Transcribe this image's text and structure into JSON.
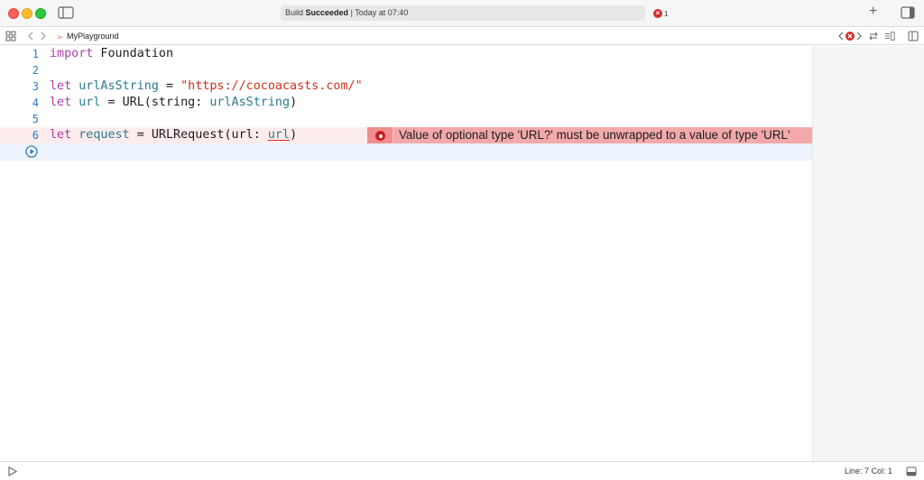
{
  "window": {
    "activity": {
      "prefix": "Build",
      "status": "Succeeded",
      "separator": "|",
      "time": "Today at 07:40"
    },
    "error_count": "1",
    "add_label": "+"
  },
  "jumpbar": {
    "file": "MyPlayground"
  },
  "editor": {
    "lines": [
      {
        "number": "1",
        "tokens": [
          {
            "t": "import",
            "k": "kw"
          },
          {
            "t": " Foundation"
          }
        ]
      },
      {
        "number": "2",
        "tokens": []
      },
      {
        "number": "3",
        "tokens": [
          {
            "t": "let",
            "k": "kw"
          },
          {
            "t": " "
          },
          {
            "t": "urlAsString",
            "k": "var"
          },
          {
            "t": " = "
          },
          {
            "t": "\"https://cocoacasts.com/\"",
            "k": "str"
          }
        ]
      },
      {
        "number": "4",
        "tokens": [
          {
            "t": "let",
            "k": "kw"
          },
          {
            "t": " "
          },
          {
            "t": "url",
            "k": "var"
          },
          {
            "t": " = URL(string: "
          },
          {
            "t": "urlAsString",
            "k": "var"
          },
          {
            "t": ")"
          }
        ]
      },
      {
        "number": "5",
        "tokens": []
      },
      {
        "number": "6",
        "tokens": [
          {
            "t": "let",
            "k": "kw"
          },
          {
            "t": " "
          },
          {
            "t": "request",
            "k": "var"
          },
          {
            "t": " = URLRequest(url: "
          },
          {
            "t": "url",
            "k": "var squiggle"
          },
          {
            "t": ")"
          }
        ]
      }
    ],
    "error_message": "Value of optional type 'URL?' must be unwrapped to a value of type 'URL'"
  },
  "statusbar": {
    "position": "Line: 7  Col: 1"
  },
  "colors": {
    "keyword": "#ad3da4",
    "variable": "#2b7b8f",
    "string": "#d12f1b",
    "line_number": "#2d79c6",
    "error": "#d72c2c",
    "error_banner": "#f3a9aa"
  }
}
